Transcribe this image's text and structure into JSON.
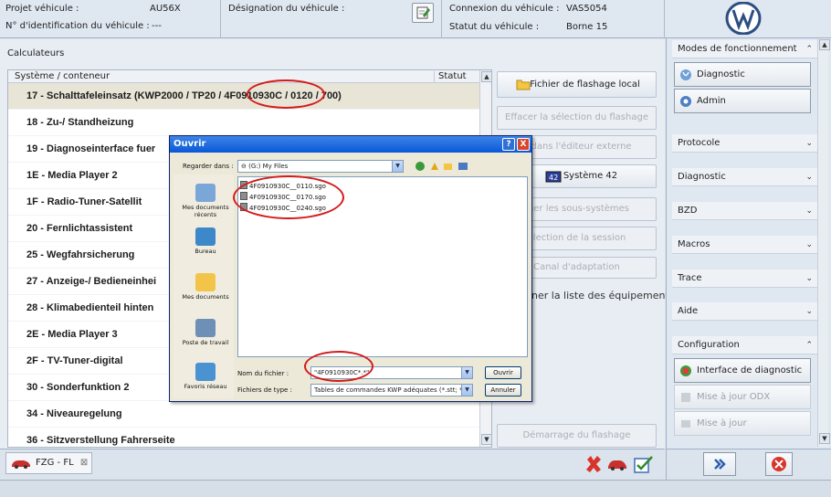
{
  "header": {
    "project_label": "Projet véhicule :",
    "project_value": "AU56X",
    "vin_label": "N° d'identification du véhicule :",
    "vin_value": "---",
    "designation_label": "Désignation du véhicule :",
    "connection_label": "Connexion du véhicule :",
    "connection_value": "VAS5054",
    "status_label": "Statut du véhicule :",
    "status_value": "Borne 15"
  },
  "main": {
    "title": "Calculateurs",
    "col_system": "Système / conteneur",
    "col_status": "Statut",
    "rows": [
      "17 - Schalttafeleinsatz  (KWP2000 / TP20 / 4F0910930C / 0120 / 700)",
      "18 - Zu-/ Standheizung",
      "19 - Diagnoseinterface fuer",
      "1E - Media Player 2",
      "1F - Radio-Tuner-Satellit",
      "20 - Fernlichtassistent",
      "25 - Wegfahrsicherung",
      "27 - Anzeige-/ Bedieneinhei",
      "28 - Klimabedienteil hinten",
      "2E - Media Player 3",
      "2F - TV-Tuner-digital",
      "30 - Sonderfunktion 2",
      "34 - Niveauregelung",
      "36 - Sitzverstellung Fahrerseite"
    ]
  },
  "actions": {
    "local_flash": "Fichier de flashage local",
    "clear_selection": "Effacer la sélection du flashage",
    "open_editor": "ir dans l'éditeur externe",
    "system42": "Système 42",
    "subsystems": "rger les sous-systèmes",
    "session": "élection de la session",
    "adaptation": "Canal d'adaptation",
    "equipment_list": "ner la liste des équipements",
    "start_flash": "Démarrage du flashage"
  },
  "sidebar": {
    "modes": "Modes de fonctionnement",
    "diagnostic_btn": "Diagnostic",
    "admin_btn": "Admin",
    "protocole": "Protocole",
    "diagnostic": "Diagnostic",
    "bzd": "BZD",
    "macros": "Macros",
    "trace": "Trace",
    "aide": "Aide",
    "configuration": "Configuration",
    "interface_btn": "Interface de diagnostic",
    "odx_btn": "Mise à jour ODX",
    "update_btn": "Mise à jour"
  },
  "bottom": {
    "tab_label": "FZG - FL",
    "tab_close": "⊠"
  },
  "dialog": {
    "title": "Ouvrir",
    "help": "?",
    "close": "X",
    "look_in_label": "Regarder dans :",
    "look_in_value": "(G:) My Files",
    "places": [
      "Mes documents récents",
      "Bureau",
      "Mes documents",
      "Poste de travail",
      "Favoris réseau"
    ],
    "files": [
      "4F0910930C__0110.sgo",
      "4F0910930C__0170.sgo",
      "4F0910930C__0240.sgo"
    ],
    "filename_label": "Nom du fichier :",
    "filename_value": "\"4F0910930C*.*\"",
    "filetype_label": "Fichiers de type :",
    "filetype_value": "Tables de commandes KWP adéquates (*.stt; *",
    "open_btn": "Ouvrir",
    "cancel_btn": "Annuler"
  },
  "colors": {
    "accent": "#d41a1a",
    "titlebar": "#0a58d8"
  }
}
